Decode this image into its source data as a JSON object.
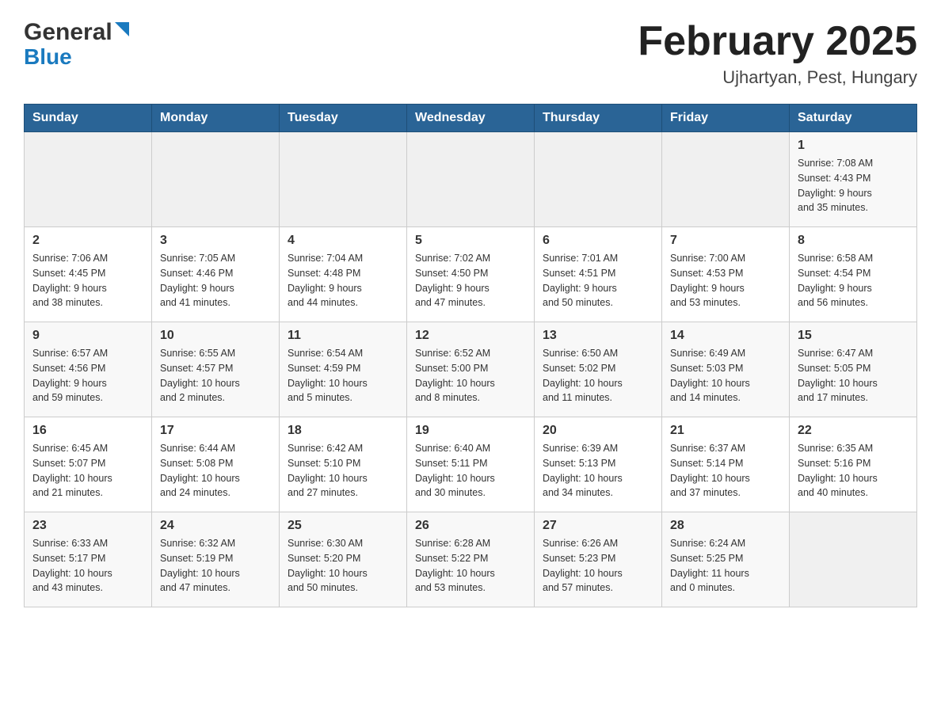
{
  "header": {
    "logo_general": "General",
    "logo_blue": "Blue",
    "month_title": "February 2025",
    "location": "Ujhartyan, Pest, Hungary"
  },
  "weekdays": [
    "Sunday",
    "Monday",
    "Tuesday",
    "Wednesday",
    "Thursday",
    "Friday",
    "Saturday"
  ],
  "weeks": [
    {
      "days": [
        {
          "num": "",
          "info": ""
        },
        {
          "num": "",
          "info": ""
        },
        {
          "num": "",
          "info": ""
        },
        {
          "num": "",
          "info": ""
        },
        {
          "num": "",
          "info": ""
        },
        {
          "num": "",
          "info": ""
        },
        {
          "num": "1",
          "info": "Sunrise: 7:08 AM\nSunset: 4:43 PM\nDaylight: 9 hours\nand 35 minutes."
        }
      ]
    },
    {
      "days": [
        {
          "num": "2",
          "info": "Sunrise: 7:06 AM\nSunset: 4:45 PM\nDaylight: 9 hours\nand 38 minutes."
        },
        {
          "num": "3",
          "info": "Sunrise: 7:05 AM\nSunset: 4:46 PM\nDaylight: 9 hours\nand 41 minutes."
        },
        {
          "num": "4",
          "info": "Sunrise: 7:04 AM\nSunset: 4:48 PM\nDaylight: 9 hours\nand 44 minutes."
        },
        {
          "num": "5",
          "info": "Sunrise: 7:02 AM\nSunset: 4:50 PM\nDaylight: 9 hours\nand 47 minutes."
        },
        {
          "num": "6",
          "info": "Sunrise: 7:01 AM\nSunset: 4:51 PM\nDaylight: 9 hours\nand 50 minutes."
        },
        {
          "num": "7",
          "info": "Sunrise: 7:00 AM\nSunset: 4:53 PM\nDaylight: 9 hours\nand 53 minutes."
        },
        {
          "num": "8",
          "info": "Sunrise: 6:58 AM\nSunset: 4:54 PM\nDaylight: 9 hours\nand 56 minutes."
        }
      ]
    },
    {
      "days": [
        {
          "num": "9",
          "info": "Sunrise: 6:57 AM\nSunset: 4:56 PM\nDaylight: 9 hours\nand 59 minutes."
        },
        {
          "num": "10",
          "info": "Sunrise: 6:55 AM\nSunset: 4:57 PM\nDaylight: 10 hours\nand 2 minutes."
        },
        {
          "num": "11",
          "info": "Sunrise: 6:54 AM\nSunset: 4:59 PM\nDaylight: 10 hours\nand 5 minutes."
        },
        {
          "num": "12",
          "info": "Sunrise: 6:52 AM\nSunset: 5:00 PM\nDaylight: 10 hours\nand 8 minutes."
        },
        {
          "num": "13",
          "info": "Sunrise: 6:50 AM\nSunset: 5:02 PM\nDaylight: 10 hours\nand 11 minutes."
        },
        {
          "num": "14",
          "info": "Sunrise: 6:49 AM\nSunset: 5:03 PM\nDaylight: 10 hours\nand 14 minutes."
        },
        {
          "num": "15",
          "info": "Sunrise: 6:47 AM\nSunset: 5:05 PM\nDaylight: 10 hours\nand 17 minutes."
        }
      ]
    },
    {
      "days": [
        {
          "num": "16",
          "info": "Sunrise: 6:45 AM\nSunset: 5:07 PM\nDaylight: 10 hours\nand 21 minutes."
        },
        {
          "num": "17",
          "info": "Sunrise: 6:44 AM\nSunset: 5:08 PM\nDaylight: 10 hours\nand 24 minutes."
        },
        {
          "num": "18",
          "info": "Sunrise: 6:42 AM\nSunset: 5:10 PM\nDaylight: 10 hours\nand 27 minutes."
        },
        {
          "num": "19",
          "info": "Sunrise: 6:40 AM\nSunset: 5:11 PM\nDaylight: 10 hours\nand 30 minutes."
        },
        {
          "num": "20",
          "info": "Sunrise: 6:39 AM\nSunset: 5:13 PM\nDaylight: 10 hours\nand 34 minutes."
        },
        {
          "num": "21",
          "info": "Sunrise: 6:37 AM\nSunset: 5:14 PM\nDaylight: 10 hours\nand 37 minutes."
        },
        {
          "num": "22",
          "info": "Sunrise: 6:35 AM\nSunset: 5:16 PM\nDaylight: 10 hours\nand 40 minutes."
        }
      ]
    },
    {
      "days": [
        {
          "num": "23",
          "info": "Sunrise: 6:33 AM\nSunset: 5:17 PM\nDaylight: 10 hours\nand 43 minutes."
        },
        {
          "num": "24",
          "info": "Sunrise: 6:32 AM\nSunset: 5:19 PM\nDaylight: 10 hours\nand 47 minutes."
        },
        {
          "num": "25",
          "info": "Sunrise: 6:30 AM\nSunset: 5:20 PM\nDaylight: 10 hours\nand 50 minutes."
        },
        {
          "num": "26",
          "info": "Sunrise: 6:28 AM\nSunset: 5:22 PM\nDaylight: 10 hours\nand 53 minutes."
        },
        {
          "num": "27",
          "info": "Sunrise: 6:26 AM\nSunset: 5:23 PM\nDaylight: 10 hours\nand 57 minutes."
        },
        {
          "num": "28",
          "info": "Sunrise: 6:24 AM\nSunset: 5:25 PM\nDaylight: 11 hours\nand 0 minutes."
        },
        {
          "num": "",
          "info": ""
        }
      ]
    }
  ]
}
